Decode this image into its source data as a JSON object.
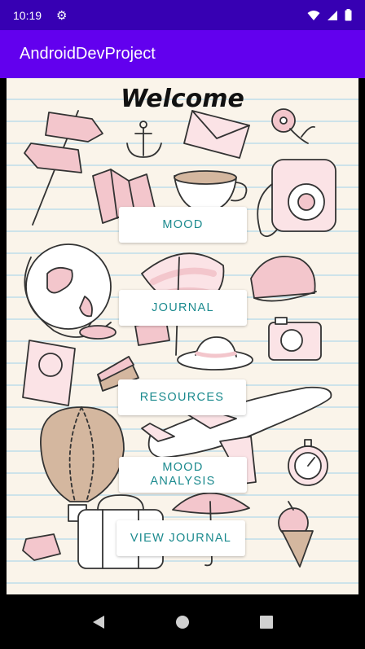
{
  "status_bar": {
    "time": "10:19"
  },
  "app_bar": {
    "title": "AndroidDevProject"
  },
  "main": {
    "welcome": "Welcome",
    "buttons": [
      "MOOD",
      "JOURNAL",
      "RESOURCES",
      "MOOD\nANALYSIS",
      "VIEW JOURNAL"
    ]
  },
  "colors": {
    "status_bar": "#3700b3",
    "app_bar": "#6200ee",
    "button_text": "#1b8a8e",
    "doodle_pink": "#f3c6cc",
    "doodle_line": "#333333"
  },
  "icons": [
    "gear-icon",
    "wifi-icon",
    "signal-icon",
    "battery-icon",
    "back-icon",
    "home-icon",
    "recents-icon"
  ]
}
